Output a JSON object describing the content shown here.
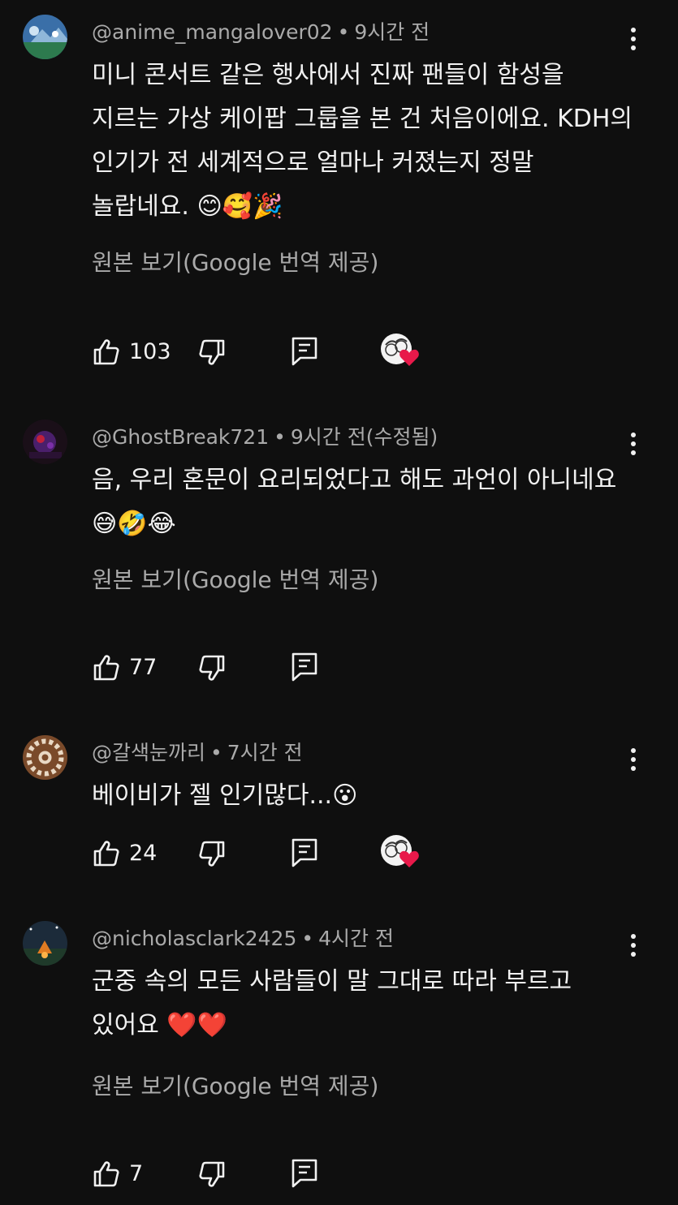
{
  "comments": [
    {
      "author": "@anime_mangalover02",
      "time": "9시간 전",
      "lines": [
        "미니 콘서트 같은 행사에서 진짜 팬들이 함성을",
        "지르는 가상 케이팝 그룹을 본 건 처음이에요. KDH의",
        "인기가 전 세계적으로 얼마나 커졌는지 정말",
        "놀랍네요. 😊🥰🎉"
      ],
      "translate_label": "원본 보기(Google 번역 제공)",
      "likes": "103",
      "creator_heart": true,
      "avatar_icon": "blue-landscape-avatar"
    },
    {
      "author": "@GhostBreak721",
      "time": "9시간 전(수정됨)",
      "lines": [
        "음, 우리 혼문이 요리되었다고 해도 과언이 아니네요",
        "😅🤣😂"
      ],
      "translate_label": "원본 보기(Google 번역 제공)",
      "likes": "77",
      "creator_heart": false,
      "avatar_icon": "dark-red-avatar"
    },
    {
      "author": "@갈색눈까리",
      "time": "7시간 전",
      "lines": [
        "베이비가 젤 인기많다...😮"
      ],
      "translate_label": "",
      "likes": "24",
      "creator_heart": true,
      "avatar_icon": "brown-pattern-avatar"
    },
    {
      "author": "@nicholasclark2425",
      "time": "4시간 전",
      "lines": [
        "군중 속의 모든 사람들이 말 그대로 따라 부르고",
        "있어요 ❤️❤️"
      ],
      "translate_label": "원본 보기(Google 번역 제공)",
      "likes": "7",
      "creator_heart": false,
      "avatar_icon": "campfire-avatar"
    }
  ],
  "colors": {
    "background": "#0f0f0f",
    "primary_text": "#f1f1f1",
    "secondary_text": "#aaaaaa",
    "heart": "#e8194a"
  }
}
